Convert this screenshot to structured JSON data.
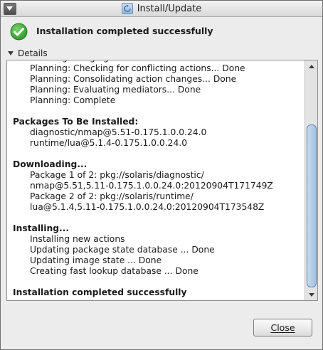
{
  "window": {
    "title": "Install/Update"
  },
  "status": {
    "message": "Installation completed successfully"
  },
  "details": {
    "label": "Details"
  },
  "log": [
    {
      "type": "indent",
      "text": "Planning: Merging actions... Done"
    },
    {
      "type": "indent",
      "text": "Planning: Checking for conflicting actions... Done"
    },
    {
      "type": "indent",
      "text": "Planning: Consolidating action changes... Done"
    },
    {
      "type": "indent",
      "text": "Planning: Evaluating mediators... Done"
    },
    {
      "type": "indent",
      "text": "Planning: Complete"
    },
    {
      "type": "gap",
      "text": ""
    },
    {
      "type": "heading",
      "text": "Packages To Be Installed:"
    },
    {
      "type": "indent",
      "text": "diagnostic/nmap@5.51-0.175.1.0.0.24.0"
    },
    {
      "type": "indent",
      "text": "runtime/lua@5.1.4-0.175.1.0.0.24.0"
    },
    {
      "type": "gap",
      "text": ""
    },
    {
      "type": "heading",
      "text": "Downloading..."
    },
    {
      "type": "indent",
      "text": "Package 1 of 2: pkg://solaris/diagnostic/"
    },
    {
      "type": "indent",
      "text": "nmap@5.51,5.11-0.175.1.0.0.24.0:20120904T171749Z"
    },
    {
      "type": "indent",
      "text": "Package 2 of 2: pkg://solaris/runtime/"
    },
    {
      "type": "indent",
      "text": "lua@5.1.4,5.11-0.175.1.0.0.24.0:20120904T173548Z"
    },
    {
      "type": "gap",
      "text": ""
    },
    {
      "type": "heading",
      "text": "Installing..."
    },
    {
      "type": "indent",
      "text": "Installing new actions"
    },
    {
      "type": "indent",
      "text": "Updating package state database ... Done"
    },
    {
      "type": "indent",
      "text": "Updating image state ... Done"
    },
    {
      "type": "indent",
      "text": "Creating fast lookup database ... Done"
    },
    {
      "type": "gap",
      "text": ""
    },
    {
      "type": "heading",
      "text": "Installation completed successfully"
    }
  ],
  "buttons": {
    "close": "Close"
  },
  "colors": {
    "success": "#2e9a2e",
    "scroll_thumb": "#a3c1df"
  },
  "icons": {
    "status": "check-circle-icon",
    "toggle": "triangle-down-icon",
    "menu": "window-menu-icon"
  }
}
